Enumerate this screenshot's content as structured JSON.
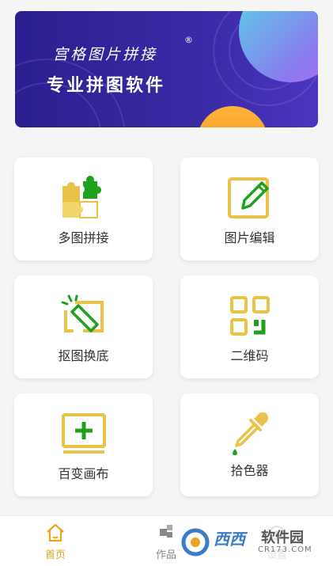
{
  "banner": {
    "subtitle": "宫格图片拼接",
    "registered_mark": "®",
    "title": "专业拼图软件"
  },
  "tools": [
    {
      "label": "多图拼接",
      "icon": "puzzle-icon"
    },
    {
      "label": "图片编辑",
      "icon": "edit-pencil-icon"
    },
    {
      "label": "抠图换底",
      "icon": "magic-wand-icon"
    },
    {
      "label": "二维码",
      "icon": "qr-code-icon"
    },
    {
      "label": "百变画布",
      "icon": "canvas-plus-icon"
    },
    {
      "label": "拾色器",
      "icon": "eyedropper-icon"
    }
  ],
  "tabbar": {
    "home_label": "首页",
    "works_label": "作品",
    "settings_label": "设置"
  },
  "watermark": {
    "brand_main": "西西",
    "brand_alt": "软件园",
    "url": "CR173.COM"
  },
  "colors": {
    "accent_yellow": "#e8c347",
    "accent_green": "#1ea21e",
    "tab_active": "#e8a51d",
    "banner_bg": "#2a1f8f"
  }
}
